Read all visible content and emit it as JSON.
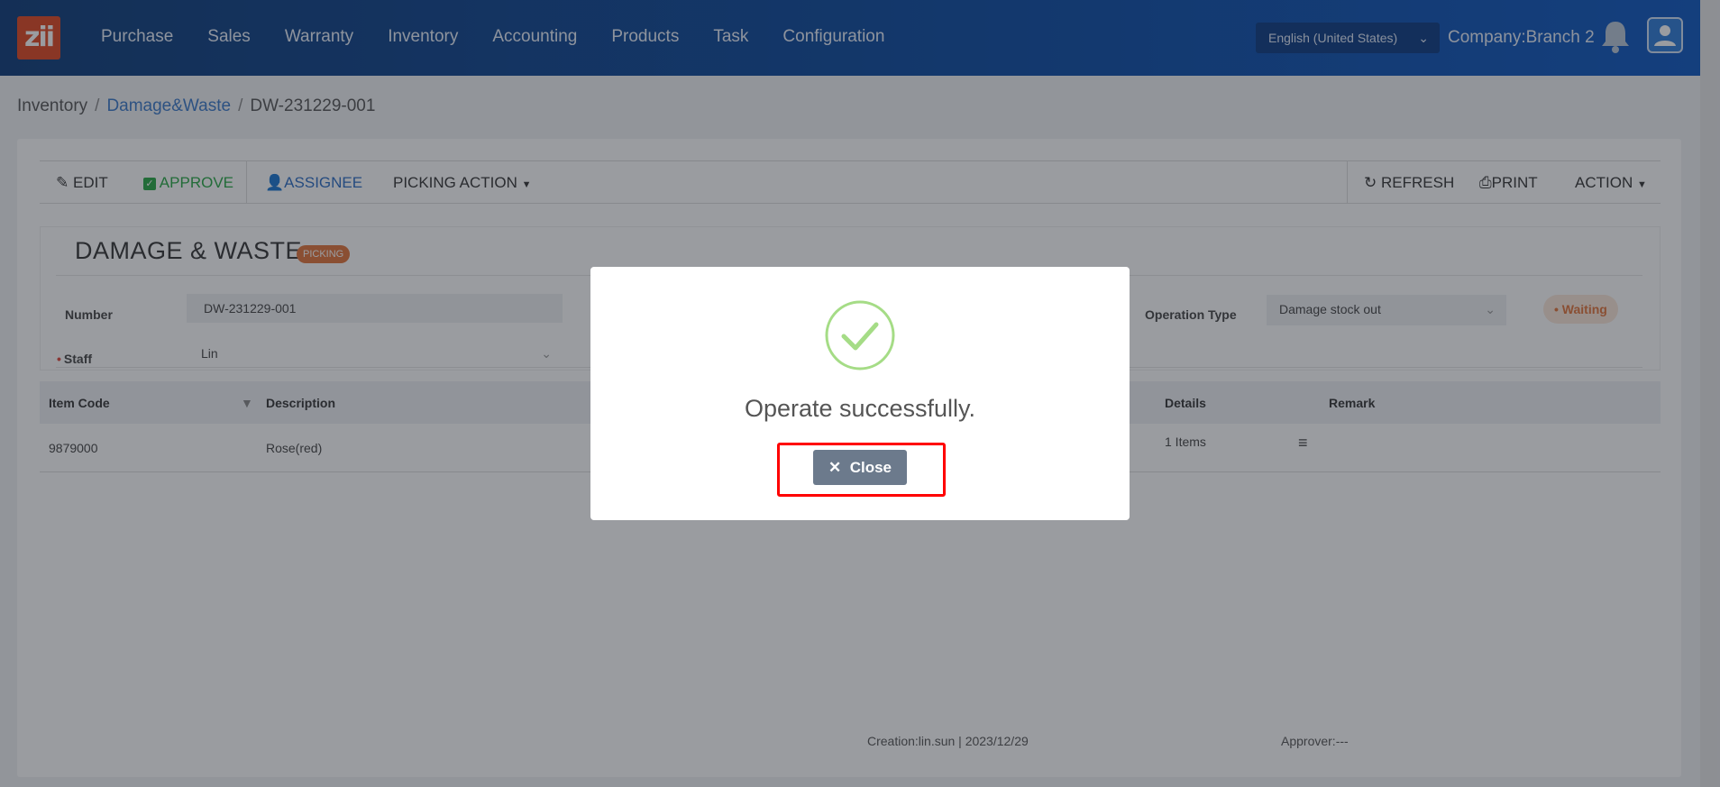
{
  "nav": {
    "logo": "zii",
    "items": [
      "Purchase",
      "Sales",
      "Warranty",
      "Inventory",
      "Accounting",
      "Products",
      "Task",
      "Configuration"
    ],
    "language": "English (United States)",
    "company": "Company:Branch 2"
  },
  "breadcrumb": {
    "root": "Inventory",
    "parent": "Damage&Waste",
    "current": "DW-231229-001"
  },
  "toolbar": {
    "edit": "EDIT",
    "approve": "APPROVE",
    "assignee": "ASSIGNEE",
    "picking_action": "PICKING ACTION",
    "refresh": "REFRESH",
    "print": "PRINT",
    "action": "ACTION"
  },
  "form": {
    "title": "DAMAGE & WASTE",
    "badge": "PICKING",
    "number_label": "Number",
    "number_value": "DW-231229-001",
    "staff_label": "Staff",
    "staff_value": "Lin",
    "operation_type_label": "Operation Type",
    "operation_type_value": "Damage stock out",
    "status": "Waiting"
  },
  "table": {
    "headers": {
      "item_code": "Item Code",
      "description": "Description",
      "details": "Details",
      "remark": "Remark"
    },
    "rows": [
      {
        "item_code": "9879000",
        "description": "Rose(red)",
        "details": "1 Items",
        "remark": ""
      }
    ]
  },
  "footer": {
    "creation": "Creation:lin.sun | 2023/12/29",
    "approver": "Approver:---"
  },
  "modal": {
    "message": "Operate successfully.",
    "close_label": "Close"
  },
  "colors": {
    "topbar": "#0a4aa3",
    "accent_green": "#27a844",
    "accent_blue": "#2b6cc4",
    "badge_orange": "#e2743a",
    "highlight": "#ff0000"
  }
}
